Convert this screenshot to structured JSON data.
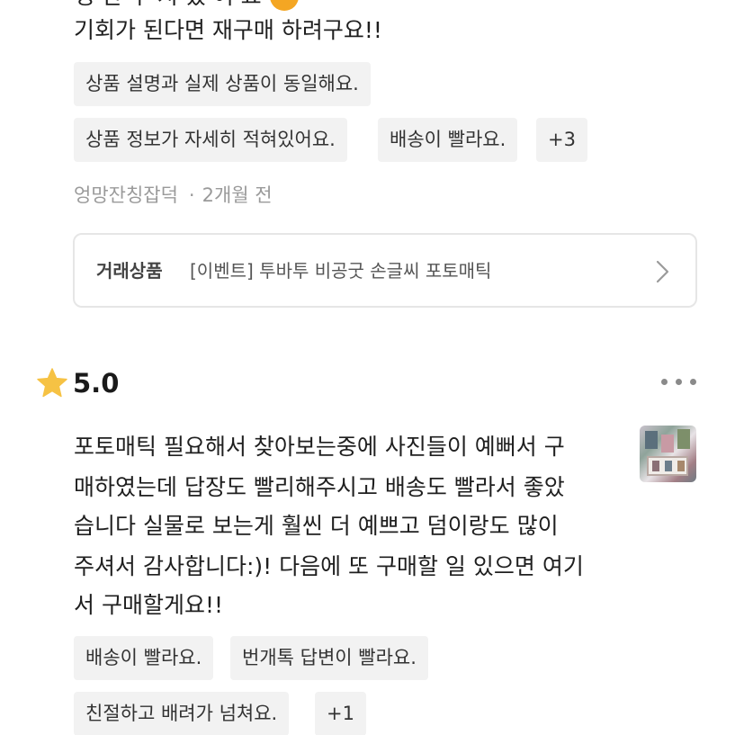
{
  "top_review": {
    "partial_line": "생 한 우 지 었 어 요",
    "last_line": "기회가 된다면 재구매 하려구요!!",
    "tags_row1": [
      "상품 설명과 실제 상품이 동일해요."
    ],
    "tags_row2": [
      "상품 정보가 자세히 적혀있어요.",
      "배송이 빨라요.",
      "+3"
    ],
    "author": "엉망잔칭잡덕",
    "time": "2개월 전",
    "product": {
      "label": "거래상품",
      "name": "[이벤트] 투바투 비공굿 손글씨 포토매틱"
    }
  },
  "second_review": {
    "rating": "5.0",
    "text_lines": [
      "포토매틱 필요해서 찾아보는중에 사진들이 예뻐서 구",
      "매하였는데 답장도 빨리해주시고 배송도 빨라서 좋았",
      "습니다 실물로 보는게 훨씬 더 예쁘고 덤이랑도 많이",
      "주셔서 감사합니다:)! 다음에 또 구매할 일 있으면 여기",
      "서 구매할게요!!"
    ],
    "tags_row1": [
      "배송이 빨라요.",
      "번개톡 답변이 빨라요."
    ],
    "tags_row2": [
      "친절하고 배려가 넘쳐요.",
      "+1"
    ]
  },
  "icons": {
    "star": "star-icon",
    "more": "more-options-icon",
    "chevron": "chevron-right-icon",
    "thumbnail": "review-photo-thumbnail"
  },
  "colors": {
    "tag_bg": "#f2f2f2",
    "star": "#f6c244",
    "meta_text": "#9a9a9a",
    "border": "#e6e6e6"
  }
}
